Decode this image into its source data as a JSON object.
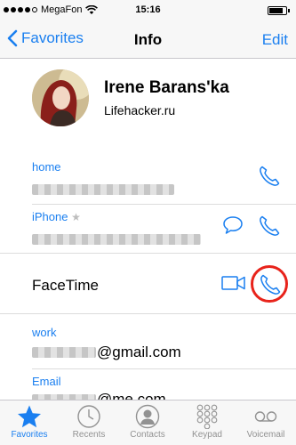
{
  "status_bar": {
    "carrier": "MegaFon",
    "time": "15:16"
  },
  "nav": {
    "back_label": "Favorites",
    "title": "Info",
    "edit_label": "Edit"
  },
  "contact": {
    "name": "Irene Barans'ka",
    "company": "Lifehacker.ru"
  },
  "fields": {
    "home_label": "home",
    "iphone_label": "iPhone",
    "facetime_label": "FaceTime",
    "work_label": "work",
    "work_value_suffix": "@gmail.com",
    "email_label": "Email",
    "email_value_suffix": "@me.com"
  },
  "tabs": [
    {
      "label": "Favorites",
      "icon": "star-icon",
      "active": true
    },
    {
      "label": "Recents",
      "icon": "clock-icon",
      "active": false
    },
    {
      "label": "Contacts",
      "icon": "person-icon",
      "active": false
    },
    {
      "label": "Keypad",
      "icon": "keypad-icon",
      "active": false
    },
    {
      "label": "Voicemail",
      "icon": "voicemail-icon",
      "active": false
    }
  ],
  "colors": {
    "accent": "#1a7ff0",
    "highlight_ring": "#e8231b",
    "bar_bg": "#f7f7f7"
  },
  "battery_level_percent": 85
}
